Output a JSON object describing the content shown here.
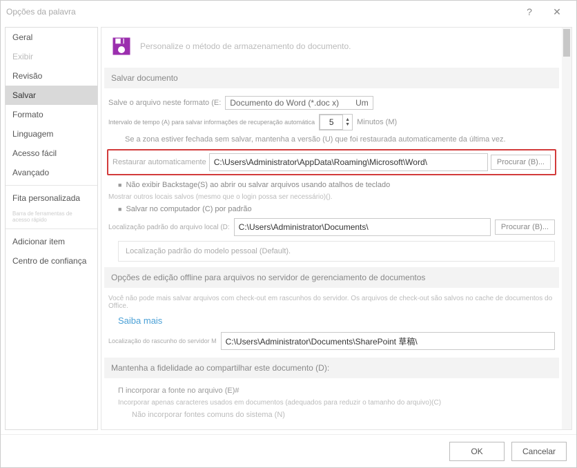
{
  "title": "Opções da palavra",
  "titlebar": {
    "help": "?",
    "close": "✕"
  },
  "sidebar": {
    "items": [
      {
        "label": "Geral"
      },
      {
        "label": "Exibir",
        "dim": true
      },
      {
        "label": "Revisão"
      },
      {
        "label": "Salvar",
        "active": true
      },
      {
        "label": "Formato"
      },
      {
        "label": "Linguagem"
      },
      {
        "label": "Acesso fácil"
      },
      {
        "label": "Avançado"
      }
    ],
    "group2": [
      {
        "label": "Fita personalizada"
      },
      {
        "label": "Barra de ferramentas de acesso rápido",
        "tiny": true
      }
    ],
    "group3": [
      {
        "label": "Adicionar item"
      },
      {
        "label": "Centro de confiança"
      }
    ]
  },
  "intro": "Personalize o método de armazenamento do documento.",
  "section_save": "Salvar documento",
  "format_row": {
    "label": "Salve o arquivo neste formato (E:",
    "value": "Documento do Word (*.doc x)",
    "unit": "Um"
  },
  "interval_row": {
    "label": "Intervalo de tempo (A) para salvar informações de recuperação automática",
    "value": "5",
    "unit": "Minutos (M)"
  },
  "keep_note": "Se a zona estiver fechada sem salvar, mantenha a versão (U) que foi restaurada automaticamente da última vez.",
  "autorecover": {
    "label": "Restaurar automaticamente",
    "path": "C:\\Users\\Administrator\\AppData\\Roaming\\Microsoft\\Word\\",
    "browse": "Procurar (B)..."
  },
  "chk_backstage": "Não exibir Backstage(S) ao abrir ou salvar arquivos usando atalhos de teclado",
  "small_login": "Mostrar outros locais salvos (mesmo que o login possa ser necessário)().",
  "chk_local": "Salvar no computador (C) por padrão",
  "local_path": {
    "label": "Localização padrão do arquivo local (D:",
    "path": "C:\\Users\\Administrator\\Documents\\",
    "browse": "Procurar (B)..."
  },
  "template": "Localização padrão do modelo pessoal (Default).",
  "section_offline": "Opções de edição offline para arquivos no servidor de gerenciamento de documentos",
  "offline_note": "Você não pode mais salvar arquivos com check-out em rascunhos do servidor. Os arquivos de check-out são salvos no cache de documentos do Office.",
  "learn_more": "Saiba mais",
  "server_draft": {
    "label": "Localização do rascunho do servidor M",
    "path": "C:\\Users\\Administrator\\Documents\\SharePoint 草稿\\"
  },
  "section_fidelity": "Mantenha a fidelidade ao compartilhar este documento (D):",
  "embed_font": "Π incorporar a fonte no arquivo (E)#",
  "embed_sub": "Incorporar apenas caracteres usados em documentos (adequados para reduzir o tamanho do arquivo)(C)",
  "embed_sys": "Não incorporar fontes comuns do sistema (N)",
  "footer": {
    "ok": "OK",
    "cancel": "Cancelar"
  }
}
